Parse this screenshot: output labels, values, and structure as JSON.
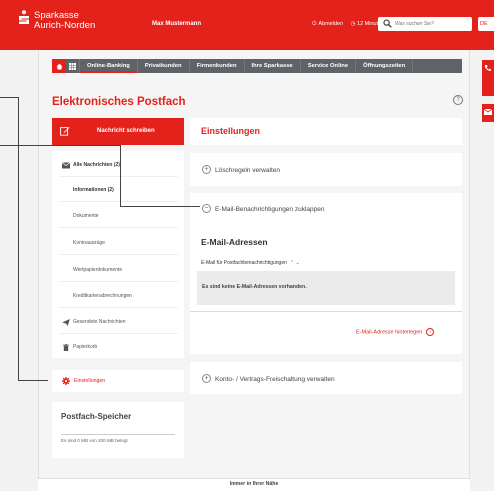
{
  "brand": {
    "line1": "Sparkasse",
    "line2": "Aurich-Norden",
    "accent": "#e3231b"
  },
  "header": {
    "user": "Max Mustermann",
    "logout": "Abmelden",
    "timer": "12 Minuten",
    "search_placeholder": "Was suchen Sie?",
    "lang": "DE"
  },
  "nav": {
    "items": [
      "Online-Banking",
      "Privatkunden",
      "Firmenkunden",
      "Ihre Sparkasse",
      "Service Online",
      "Öffnungszeiten"
    ]
  },
  "page": {
    "title": "Elektronisches Postfach",
    "help": "?"
  },
  "left": {
    "compose": "Nachricht schreiben",
    "all_messages": "Alle Nachrichten (2)",
    "informationen": "Informationen (2)",
    "dokumente": "Dokumente",
    "kontoauszuege": "Kontoauszüge",
    "wertpapier": "Wertpapierdokumente",
    "kreditkarten": "Kreditkartenabrechnungen",
    "gesendet": "Gesendete Nachrichten",
    "papierkorb": "Papierkorb",
    "einstellungen": "Einstellungen"
  },
  "storage": {
    "title": "Postfach-Speicher",
    "text": "Es sind 0 MB von 200 MB belegt"
  },
  "right": {
    "settings_title": "Einstellungen",
    "loeschregeln": "Löschregeln verwalten",
    "email_toggle": "E-Mail-Benachrichtigungen zuklappen",
    "email_title": "E-Mail-Adressen",
    "email_filter": "E-Mail für Postfachbenachrichtigungen",
    "email_empty": "Es sind keine E-Mail-Adressen vorhanden.",
    "email_add": "E-Mail-Adresse hinterlegen",
    "konto": "Konto- / Vertrags-Freischaltung verwalten"
  },
  "footer": {
    "text": "Immer in Ihrer Nähe"
  }
}
